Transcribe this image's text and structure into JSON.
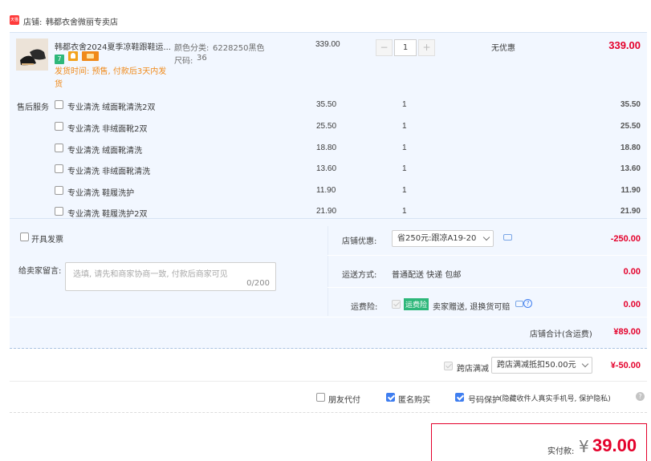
{
  "shop": {
    "badge_text": "天猫",
    "label": "店铺:",
    "name": "韩都衣舍微丽专卖店"
  },
  "product": {
    "title": "韩都衣舍2024夏季凉鞋跟鞋运...",
    "color_label": "颜色分类:",
    "color_value": "6228250黑色",
    "size_label": "尺码:",
    "size_value": "36",
    "unit_price": "339.00",
    "quantity": "1",
    "discount_text": "无优惠",
    "total": "339.00",
    "ship_notice_line1": "发货时间:  预售, 付款后3天内发",
    "ship_notice_line2": "货",
    "tag_colors": [
      "#2db77a",
      "#f2a21c",
      "#f08a1a"
    ]
  },
  "after_sales": {
    "label": "售后服务",
    "items": [
      {
        "name": "专业清洗 绒面靴清洗2双",
        "price": "35.50",
        "qty": "1",
        "total": "35.50"
      },
      {
        "name": "专业清洗 非绒面靴2双",
        "price": "25.50",
        "qty": "1",
        "total": "25.50"
      },
      {
        "name": "专业清洗 绒面靴清洗",
        "price": "18.80",
        "qty": "1",
        "total": "18.80"
      },
      {
        "name": "专业清洗 非绒面靴清洗",
        "price": "13.60",
        "qty": "1",
        "total": "13.60"
      },
      {
        "name": "专业清洗 鞋履洗护",
        "price": "11.90",
        "qty": "1",
        "total": "11.90"
      },
      {
        "name": "专业清洗 鞋履洗护2双",
        "price": "21.90",
        "qty": "1",
        "total": "21.90"
      }
    ]
  },
  "invoice": {
    "label": "开具发票"
  },
  "message": {
    "label": "给卖家留言:",
    "placeholder": "选填, 请先和商家协商一致, 付款后商家可见",
    "counter": "0/200"
  },
  "store_discount": {
    "label": "店铺优惠:",
    "selected": "省250元:跟凉A19-20",
    "amount": "-250.00"
  },
  "shipping": {
    "label": "运送方式:",
    "value": "普通配送 快递 包邮",
    "amount": "0.00"
  },
  "freight_insurance": {
    "label": "运费险:",
    "badge": "运费险",
    "text": "卖家赠送, 退换货可赔",
    "amount": "0.00"
  },
  "shop_total": {
    "label": "店铺合计(含运费)",
    "amount": "¥89.00"
  },
  "cross_store": {
    "label": "跨店满减",
    "selected": "跨店满减抵扣50.00元",
    "amount": "¥-50.00"
  },
  "options": {
    "friend_pay": "朋友代付",
    "anonymous": "匿名购买",
    "number_protect": "号码保护",
    "number_protect_desc": "(隐藏收件人真实手机号, 保护隐私)"
  },
  "payment": {
    "label": "实付款:",
    "currency": "¥",
    "amount": "39.00"
  },
  "colors": {
    "accent_red": "#e4002b",
    "light_blue_bg": "#f2f7ff",
    "check_blue": "#3f7ef0",
    "orange_text": "#f08a1a"
  }
}
